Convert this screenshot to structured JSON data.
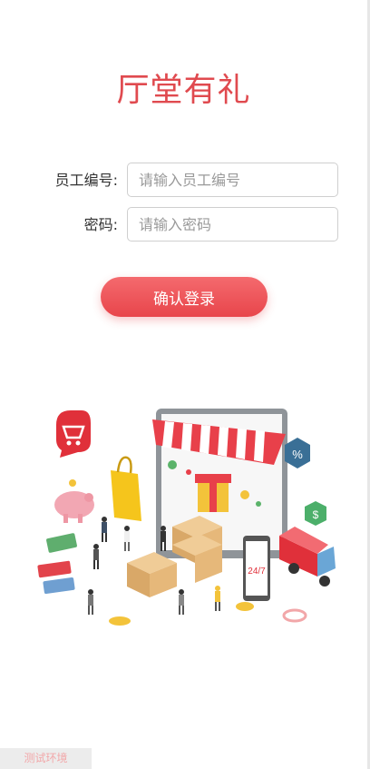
{
  "app": {
    "title": "厅堂有礼"
  },
  "form": {
    "employee_id": {
      "label": "员工编号:",
      "placeholder": "请输入员工编号",
      "value": ""
    },
    "password": {
      "label": "密码:",
      "placeholder": "请输入密码",
      "value": ""
    },
    "submit_label": "确认登录"
  },
  "illustration": {
    "icon": "ecommerce-shopping-illustration",
    "badges": {
      "percent": "%",
      "dollar": "$",
      "open_hours": "24/7"
    }
  },
  "environment_badge": "测试环境",
  "colors": {
    "accent": "#e04a4f",
    "button_top": "#f46a6e",
    "button_bottom": "#e8454b"
  }
}
